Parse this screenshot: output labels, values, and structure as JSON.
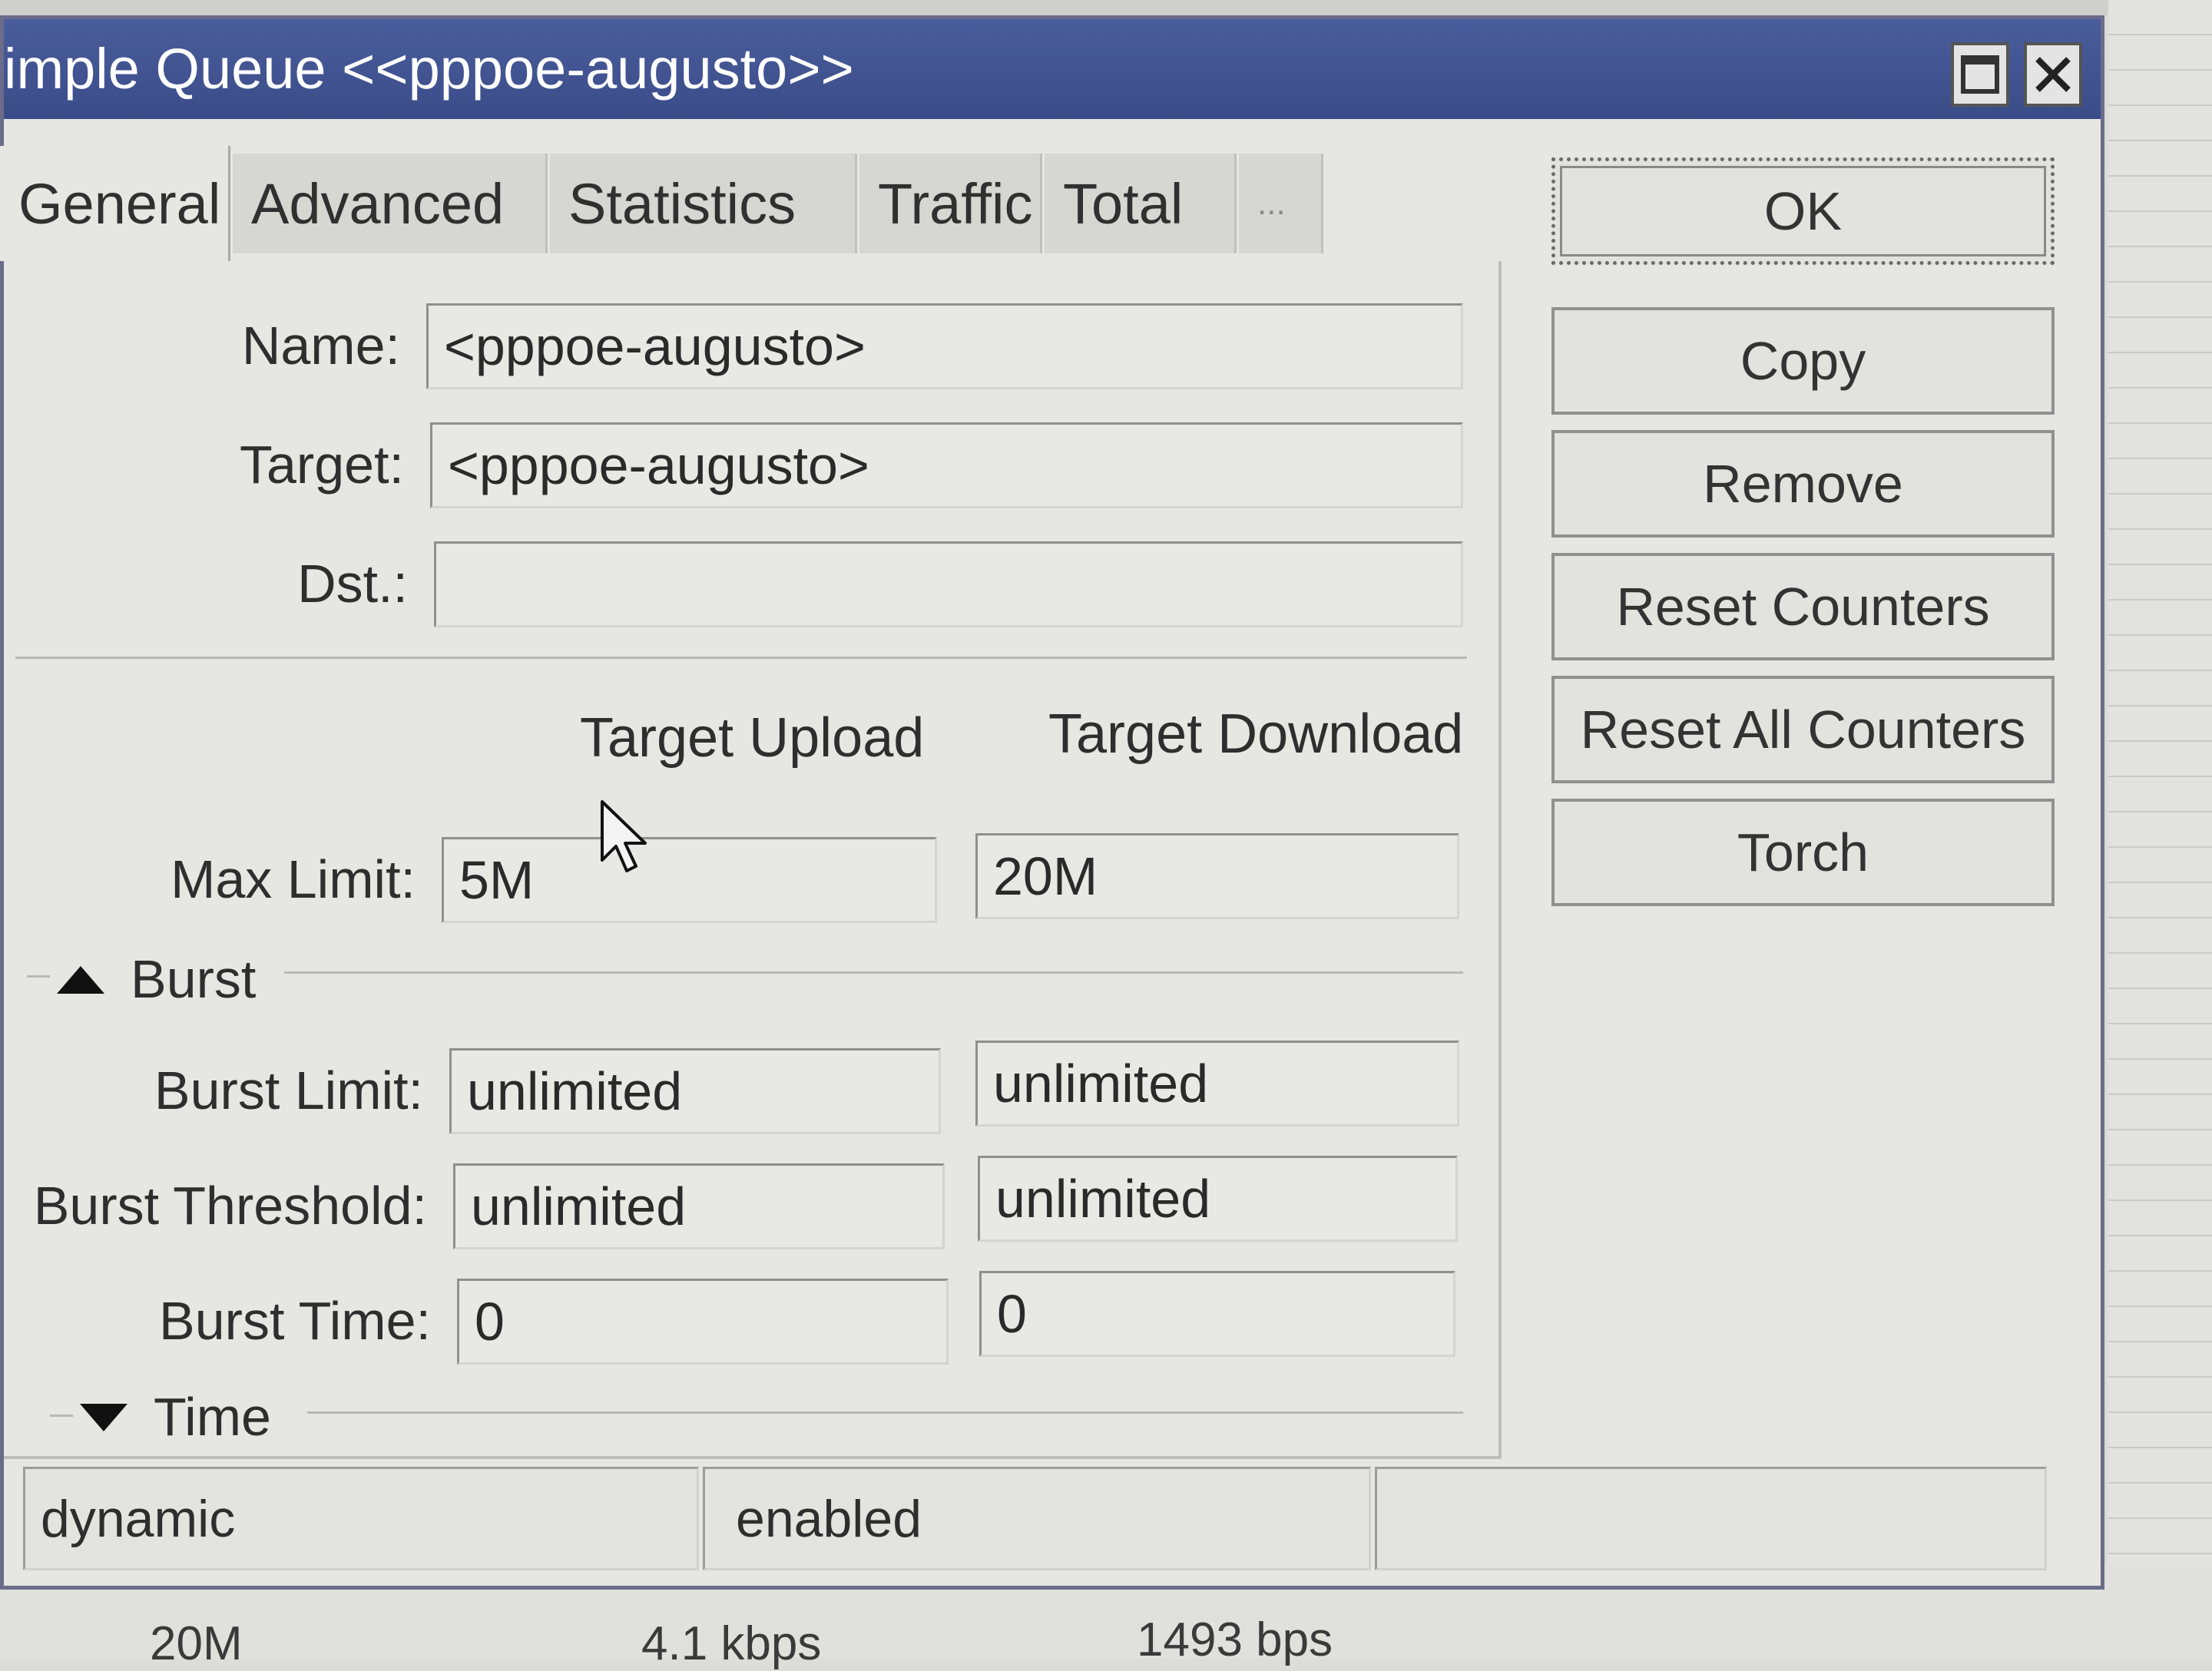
{
  "window": {
    "title": "imple Queue <<pppoe-augusto>>",
    "maximize_icon": "maximize-icon",
    "close_icon": "close-icon"
  },
  "tabs": [
    {
      "label": "General",
      "active": true
    },
    {
      "label": "Advanced",
      "active": false
    },
    {
      "label": "Statistics",
      "active": false
    },
    {
      "label": "Traffic",
      "active": false
    },
    {
      "label": "Total",
      "active": false
    },
    {
      "label": "...",
      "active": false
    }
  ],
  "form": {
    "name_label": "Name:",
    "name_value": "<pppoe-augusto>",
    "target_label": "Target:",
    "target_value": "<pppoe-augusto>",
    "dst_label": "Dst.:",
    "dst_value": "",
    "col_upload": "Target Upload",
    "col_download": "Target Download",
    "max_limit_label": "Max Limit:",
    "max_limit_upload": "5M",
    "max_limit_download": "20M",
    "burst_section": "Burst",
    "burst_limit_label": "Burst Limit:",
    "burst_limit_upload": "unlimited",
    "burst_limit_download": "unlimited",
    "burst_threshold_label": "Burst Threshold:",
    "burst_threshold_upload": "unlimited",
    "burst_threshold_download": "unlimited",
    "burst_time_label": "Burst Time:",
    "burst_time_upload": "0",
    "burst_time_download": "0",
    "time_section": "Time"
  },
  "buttons": {
    "ok": "OK",
    "copy": "Copy",
    "remove": "Remove",
    "reset_counters": "Reset Counters",
    "reset_all_counters": "Reset All Counters",
    "torch": "Torch"
  },
  "statusbar": {
    "state": "dynamic",
    "enabled": "enabled",
    "extra": ""
  },
  "background_list": {
    "row1": [
      "20M",
      "4.1 kbps",
      "1493 bps"
    ]
  },
  "colors": {
    "titlebar": "#3f5190",
    "dialog_bg": "#e6e6e2"
  }
}
